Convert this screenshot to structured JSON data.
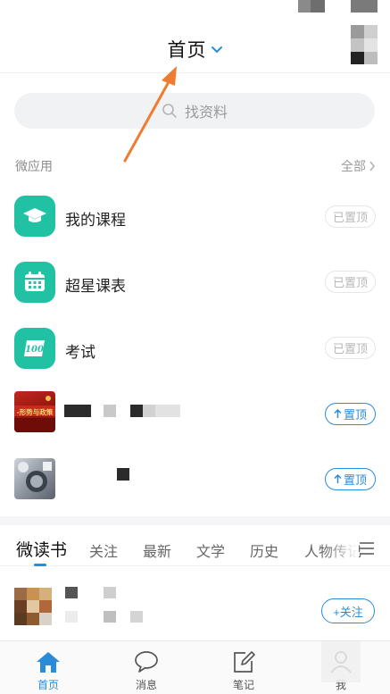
{
  "header": {
    "title": "首页"
  },
  "search": {
    "placeholder": "找资料"
  },
  "section": {
    "title": "微应用",
    "all_label": "全部"
  },
  "apps": [
    {
      "label": "我的课程",
      "pin_label": "已置顶",
      "pinned": true,
      "icon": "graduation-cap-icon"
    },
    {
      "label": "超星课表",
      "pin_label": "已置顶",
      "pinned": true,
      "icon": "calendar-icon"
    },
    {
      "label": "考试",
      "pin_label": "已置顶",
      "pinned": true,
      "icon": "exam-100-icon"
    },
    {
      "label": "",
      "pin_label": "置顶",
      "pinned": false,
      "icon": "book-thumbnail",
      "thumb_text": "-形势与政策"
    },
    {
      "label": "",
      "pin_label": "置顶",
      "pinned": false,
      "icon": "app-thumbnail"
    }
  ],
  "tabs": [
    {
      "label": "微读书",
      "active": true
    },
    {
      "label": "关注"
    },
    {
      "label": "最新"
    },
    {
      "label": "文学"
    },
    {
      "label": "历史"
    },
    {
      "label": "人物传记"
    }
  ],
  "feed": {
    "follow_label": "+关注"
  },
  "nav": [
    {
      "label": "首页",
      "icon": "home-icon",
      "active": true
    },
    {
      "label": "消息",
      "icon": "chat-bubble-icon"
    },
    {
      "label": "笔记",
      "icon": "note-edit-icon"
    },
    {
      "label": "我",
      "icon": "user-icon"
    }
  ],
  "colors": {
    "accent": "#2a8bd9",
    "app_green": "#21c2a4",
    "annotation_arrow": "#f07c30"
  }
}
